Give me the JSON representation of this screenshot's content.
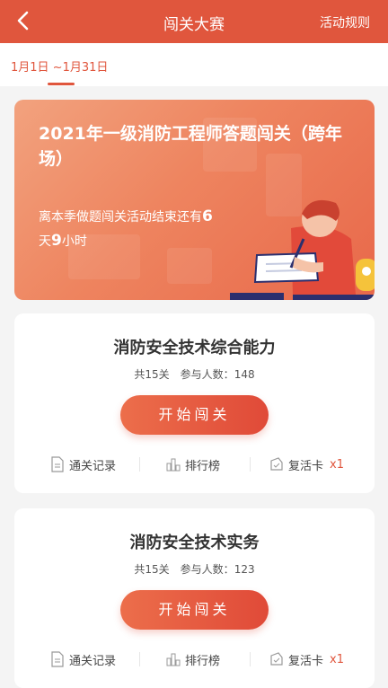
{
  "header": {
    "title": "闯关大赛",
    "rules_label": "活动规则"
  },
  "date_range": "1月1日 ~1月31日",
  "banner": {
    "title": "2021年一级消防工程师答题闯关（跨年场）",
    "countdown_prefix": "离本季做题闯关活动结束还有",
    "days": "6",
    "day_unit": "天",
    "hours": "9",
    "hour_unit": "小时"
  },
  "cards": [
    {
      "name": "消防安全技术综合能力",
      "levels": "共15关",
      "participants_label": "参与人数：",
      "participants": "148",
      "start_label": "开始闯关",
      "actions": {
        "records": "通关记录",
        "ranking": "排行榜",
        "revive": "复活卡",
        "revive_count": "x1"
      }
    },
    {
      "name": "消防安全技术实务",
      "levels": "共15关",
      "participants_label": "参与人数：",
      "participants": "123",
      "start_label": "开始闯关",
      "actions": {
        "records": "通关记录",
        "ranking": "排行榜",
        "revive": "复活卡",
        "revive_count": "x1"
      }
    }
  ],
  "colors": {
    "accent": "#e0563d",
    "background": "#f4f4f4"
  }
}
